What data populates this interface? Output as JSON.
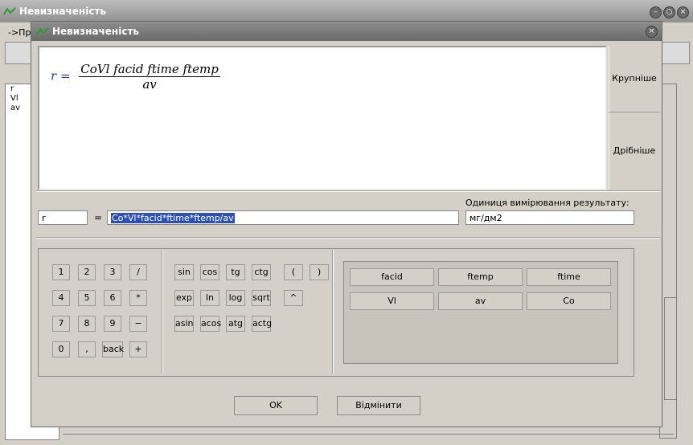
{
  "background_window": {
    "title": "Невизначеність",
    "breadcrumb": "->При",
    "list_items": [
      "r",
      "Vl",
      "av"
    ]
  },
  "dialog": {
    "title": "Невизначеність",
    "formula": {
      "lhs": "r =",
      "numerator": "CoVl facid ftime ftemp",
      "denominator": "av"
    },
    "size_buttons": {
      "bigger": "Крупніше",
      "smaller": "Дрібніше"
    },
    "result_var": "r",
    "equals": "=",
    "expression": "Co*Vl*facid*ftime*ftemp/av",
    "unit_label": "Одиниця вимірювання результату:",
    "unit_value": "мг/дм2",
    "digit_keys": [
      [
        "1",
        "2",
        "3",
        "/"
      ],
      [
        "4",
        "5",
        "6",
        "*"
      ],
      [
        "7",
        "8",
        "9",
        "−"
      ],
      [
        "0",
        ",",
        "back",
        "+"
      ]
    ],
    "function_keys": [
      [
        "sin",
        "cos",
        "tg",
        "ctg"
      ],
      [
        "exp",
        "ln",
        "log",
        "sqrt"
      ],
      [
        "asin",
        "acos",
        "atg",
        "actg"
      ]
    ],
    "paren_keys": [
      "(",
      ")",
      "^"
    ],
    "variable_buttons": [
      "facid",
      "ftemp",
      "ftime",
      "Vl",
      "av",
      "Co"
    ],
    "ok_label": "OK",
    "cancel_label": "Відмінити"
  }
}
